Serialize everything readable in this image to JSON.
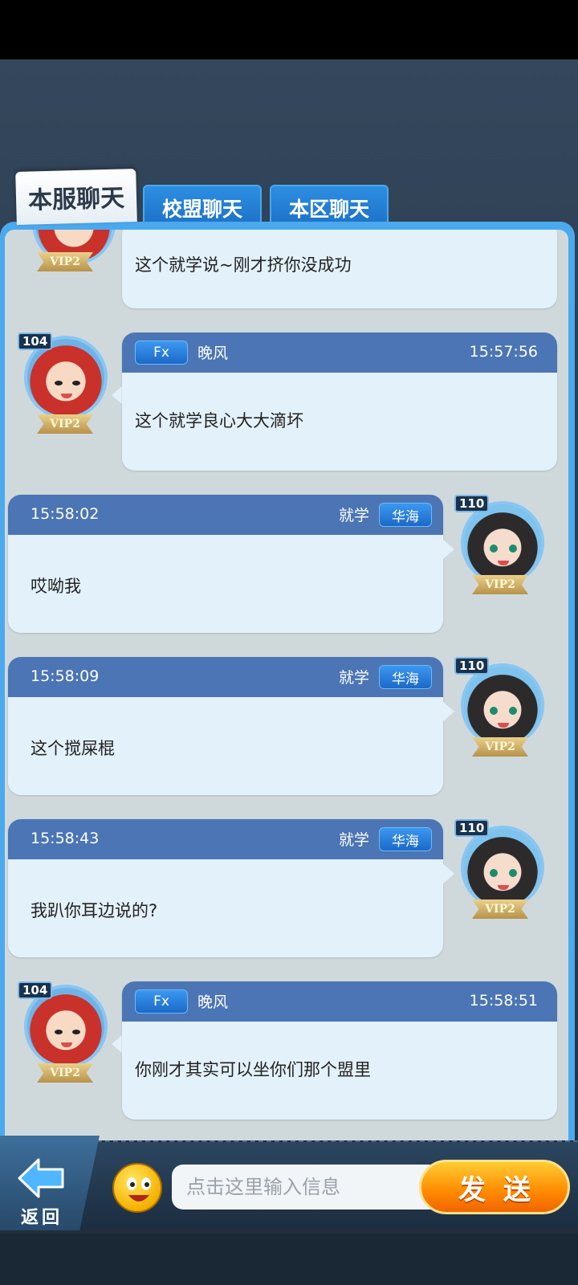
{
  "tabs": [
    {
      "label": "本服聊天",
      "active": true
    },
    {
      "label": "校盟聊天",
      "active": false
    },
    {
      "label": "本区聊天",
      "active": false
    }
  ],
  "messages": [
    {
      "side": "left",
      "level": "",
      "vip": "VIP2",
      "badge": "",
      "name": "",
      "time": "",
      "text": "这个就学说~刚才挤你没成功"
    },
    {
      "side": "left",
      "level": "104",
      "vip": "VIP2",
      "badge": "Fx",
      "name": "晚风",
      "time": "15:57:56",
      "text": "这个就学良心大大滴坏"
    },
    {
      "side": "right",
      "level": "110",
      "vip": "VIP2",
      "badge": "华海",
      "name": "就学",
      "time": "15:58:02",
      "text": "哎呦我"
    },
    {
      "side": "right",
      "level": "110",
      "vip": "VIP2",
      "badge": "华海",
      "name": "就学",
      "time": "15:58:09",
      "text": "这个搅屎棍"
    },
    {
      "side": "right",
      "level": "110",
      "vip": "VIP2",
      "badge": "华海",
      "name": "就学",
      "time": "15:58:43",
      "text": "我趴你耳边说的?"
    },
    {
      "side": "left",
      "level": "104",
      "vip": "VIP2",
      "badge": "Fx",
      "name": "晚风",
      "time": "15:58:51",
      "text": "你刚才其实可以坐你们那个盟里"
    }
  ],
  "bottom": {
    "back_label": "返回",
    "input_placeholder": "点击这里输入信息",
    "send_label": "发送"
  },
  "colors": {
    "tab_active": "#ffffff",
    "tab_inactive": "#1b6fc4",
    "bubble_header": "#4b75b4",
    "bubble_body": "#e3f1fb",
    "send_button": "#ff8a00"
  }
}
